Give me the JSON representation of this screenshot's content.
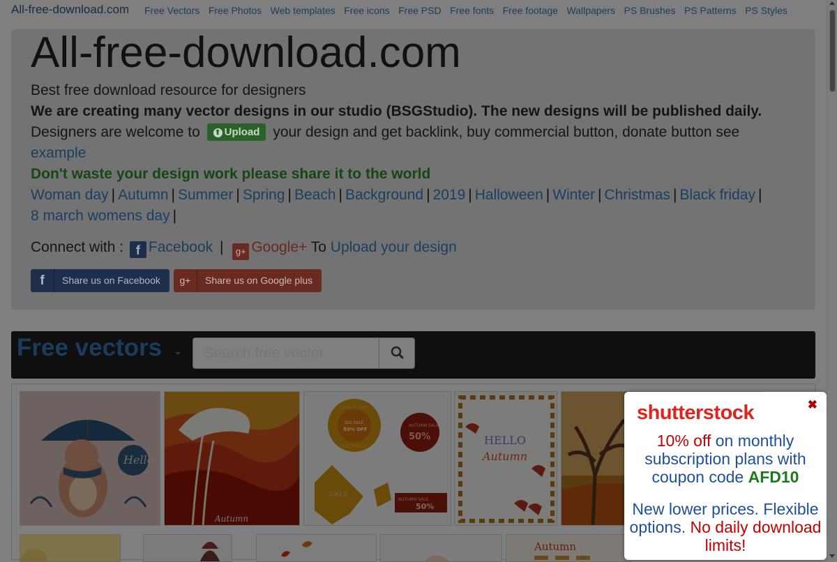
{
  "nav": {
    "brand": "All-free-download.com",
    "links": [
      "Free Vectors",
      "Free Photos",
      "Web templates",
      "Free icons",
      "Free PSD",
      "Free fonts",
      "Free footage",
      "Wallpapers",
      "PS Brushes",
      "PS Patterns",
      "PS Styles"
    ]
  },
  "jumbo": {
    "title": "All-free-download.com",
    "tagline": "Best free download resource for designers",
    "studio_note": "We are creating many vector designs in our studio (BSGStudio). The new designs will be published daily.",
    "designers_pre": "Designers are welcome to",
    "upload_button": "Upload",
    "designers_post": "your design and get backlink, buy commercial button, donate button see",
    "example_link": "example",
    "share_appeal": "Don't waste your design work please share it to the world",
    "topics": [
      "Woman day",
      "Autumn",
      "Summer",
      "Spring",
      "Beach",
      "Background",
      "2019",
      "Halloween",
      "Winter",
      "Christmas",
      "Black friday",
      "8 march womens day"
    ],
    "topic_separator": "|",
    "connect_label": "Connect with :",
    "facebook_link": "Facebook",
    "google_link": "Google+",
    "to_label": "To",
    "upload_design_link": "Upload your design",
    "share_fb": "Share us on Facebook",
    "share_gp": "Share us on Google plus"
  },
  "vectors": {
    "title": "Free vectors",
    "search_placeholder": "Search free vector"
  },
  "thumbnails": {
    "t1_text": "Hello",
    "t2_text": "Autumn",
    "t3_sample": "SAMPLE TEXT",
    "t3_big_sale": "BIG SALE",
    "t3_50_off": "50% OFF",
    "t3_best_price": "BEST PRICE",
    "t3_autumn_sale": "AUTUMN SALE",
    "t3_50": "50%",
    "t3_sale": "SALE",
    "t3_autumn_sale_2": "AUTUMN SALE",
    "t3_50_2": "50%",
    "t4_text_1": "HELLO",
    "t4_text_2": "Autumn",
    "r2e_text": "Autumn"
  },
  "popup": {
    "logo": "shutterstock",
    "close": "✖",
    "offer_red": "10% off",
    "offer_text": "on monthly subscription plans with coupon code",
    "coupon_code": "AFD10",
    "prices_text": "New lower prices. Flexible options.",
    "prices_red": "No daily download limits!"
  },
  "colors": {
    "overlay_bg": "#7f7f7f",
    "link": "#1b3e63",
    "facebook": "#1f2e4a",
    "google": "#692a22",
    "popup_red": "#e2231a",
    "popup_blue": "#1e4f9c",
    "popup_green": "#1b7a1b"
  }
}
